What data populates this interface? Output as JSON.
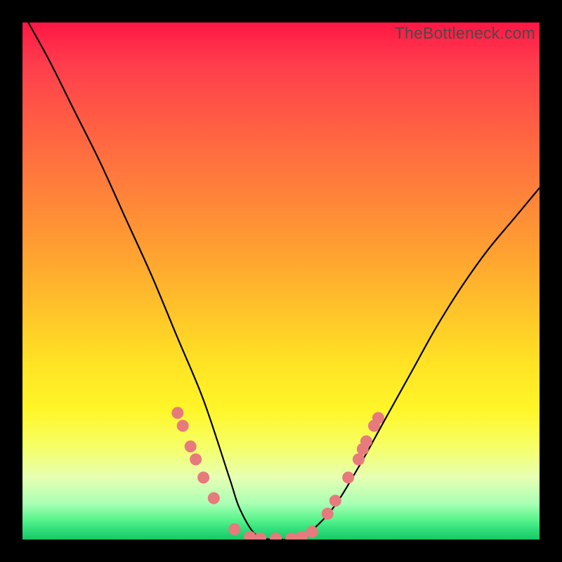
{
  "watermark": "TheBottleneck.com",
  "chart_data": {
    "type": "line",
    "title": "",
    "xlabel": "",
    "ylabel": "",
    "xlim": [
      0,
      100
    ],
    "ylim": [
      0,
      100
    ],
    "curve": {
      "name": "bottleneck-curve",
      "x": [
        0,
        5,
        10,
        15,
        20,
        25,
        30,
        35,
        40,
        42,
        45,
        48,
        50,
        52,
        55,
        60,
        65,
        70,
        75,
        80,
        85,
        90,
        95,
        100
      ],
      "y": [
        102,
        93,
        83,
        73,
        62,
        51,
        39,
        27,
        12,
        6,
        1,
        0,
        0,
        0,
        1,
        6,
        14,
        23,
        32,
        41,
        49,
        56,
        62,
        68
      ]
    },
    "markers": {
      "name": "highlighted-points",
      "color": "#e77a7d",
      "radius": 8,
      "points": [
        [
          30.0,
          24.5
        ],
        [
          31.0,
          22.0
        ],
        [
          32.5,
          18.0
        ],
        [
          33.5,
          15.5
        ],
        [
          35.0,
          12.0
        ],
        [
          37.0,
          8.0
        ],
        [
          41.0,
          2.0
        ],
        [
          44.0,
          0.5
        ],
        [
          46.0,
          0.2
        ],
        [
          49.0,
          0.2
        ],
        [
          52.0,
          0.2
        ],
        [
          54.0,
          0.5
        ],
        [
          56.0,
          1.5
        ],
        [
          59.0,
          5.0
        ],
        [
          60.5,
          7.5
        ],
        [
          63.0,
          12.0
        ],
        [
          65.0,
          15.5
        ],
        [
          65.8,
          17.5
        ],
        [
          66.5,
          19.0
        ],
        [
          68.0,
          22.0
        ],
        [
          68.8,
          23.5
        ]
      ]
    },
    "gradient_stops": [
      {
        "pos": 0.0,
        "color": "#ff1744"
      },
      {
        "pos": 0.18,
        "color": "#ff5a45"
      },
      {
        "pos": 0.42,
        "color": "#ff9a33"
      },
      {
        "pos": 0.66,
        "color": "#ffe324"
      },
      {
        "pos": 0.82,
        "color": "#f6ff66"
      },
      {
        "pos": 0.93,
        "color": "#aaffb5"
      },
      {
        "pos": 1.0,
        "color": "#19c765"
      }
    ]
  }
}
